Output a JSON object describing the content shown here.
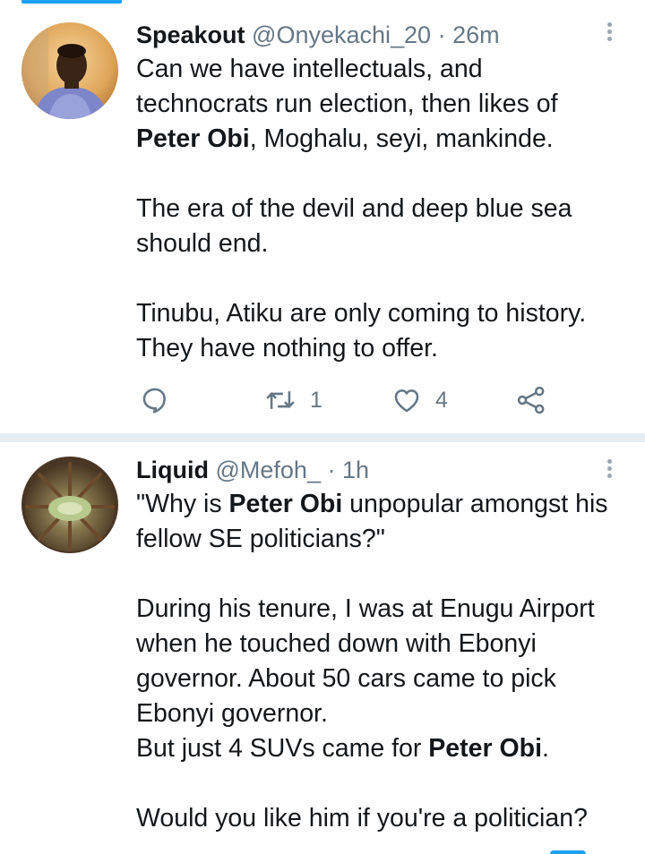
{
  "tweets": [
    {
      "name": "Speakout",
      "handle": "@Onyekachi_20",
      "sep": "·",
      "time": "26m",
      "avatar_icon": "user-photo-avatar",
      "lines": [
        [
          "Can we have intellectuals, and"
        ],
        [
          "technocrats run election, then likes of"
        ],
        [
          {
            "b": "Peter Obi"
          },
          ", Moghalu, seyi, mankinde."
        ],
        [],
        [
          "The era of the devil and deep blue sea"
        ],
        [
          "should end."
        ],
        [],
        [
          "Tinubu, Atiku are only coming to history."
        ],
        [
          "They have nothing to offer."
        ]
      ],
      "reply_count": "",
      "retweet_count": "1",
      "like_count": "4"
    },
    {
      "name": "Liquid",
      "handle": "@Mefoh_",
      "sep": "·",
      "time": "1h",
      "avatar_icon": "sea-anemone-avatar",
      "lines": [
        [
          "\"Why is ",
          {
            "b": "Peter Obi"
          },
          " unpopular amongst his"
        ],
        [
          "fellow SE politicians?\""
        ],
        [],
        [
          "During his tenure, I was at Enugu Airport"
        ],
        [
          "when he touched down with Ebonyi"
        ],
        [
          "governor. About 50 cars came to pick"
        ],
        [
          "Ebonyi governor."
        ],
        [
          "But just 4 SUVs came for ",
          {
            "b": "Peter Obi"
          },
          "."
        ],
        [],
        [
          "Would you like him if you're a politician?"
        ]
      ]
    }
  ],
  "colors": {
    "accent": "#1da1f2",
    "icon": "#657786",
    "divider": "#e6ecf0"
  }
}
